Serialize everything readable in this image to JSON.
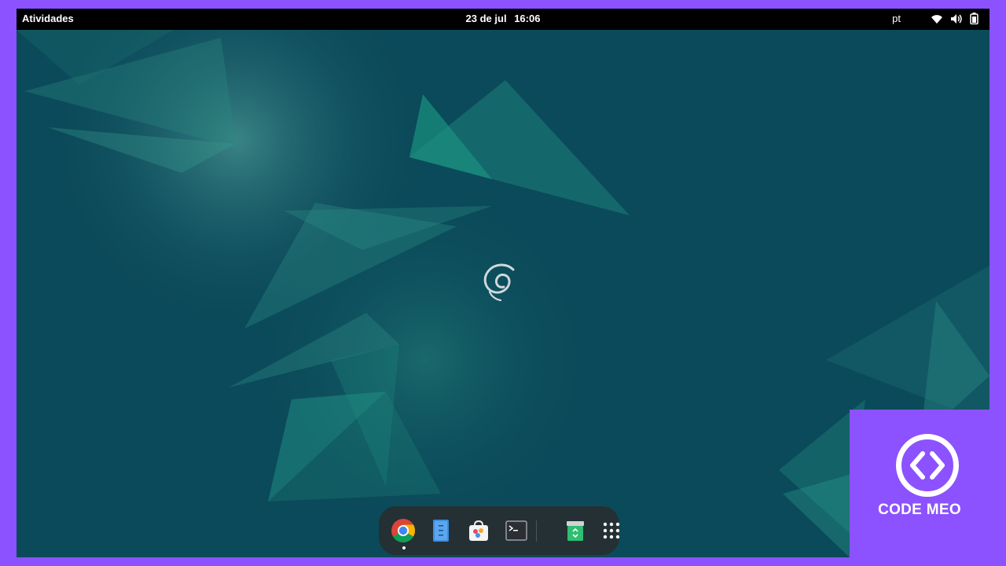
{
  "topbar": {
    "activities_label": "Atividades",
    "date": "23 de jul",
    "time": "16:06",
    "language": "pt",
    "icons": [
      "wifi-icon",
      "volume-icon",
      "battery-icon"
    ]
  },
  "desktop": {
    "logo": "debian-swirl-logo",
    "background_color": "#0c4b5b"
  },
  "dock": {
    "items": [
      {
        "name": "chrome",
        "icon": "chrome-icon",
        "running": true
      },
      {
        "name": "files",
        "icon": "files-icon",
        "running": false
      },
      {
        "name": "software",
        "icon": "software-store-icon",
        "running": false
      },
      {
        "name": "terminal",
        "icon": "terminal-icon",
        "running": false
      },
      {
        "name": "trash",
        "icon": "trash-icon",
        "running": false
      },
      {
        "name": "app-grid",
        "icon": "app-grid-icon",
        "running": false
      }
    ]
  },
  "watermark": {
    "label": "CODE MEO",
    "color": "#8c52ff"
  }
}
